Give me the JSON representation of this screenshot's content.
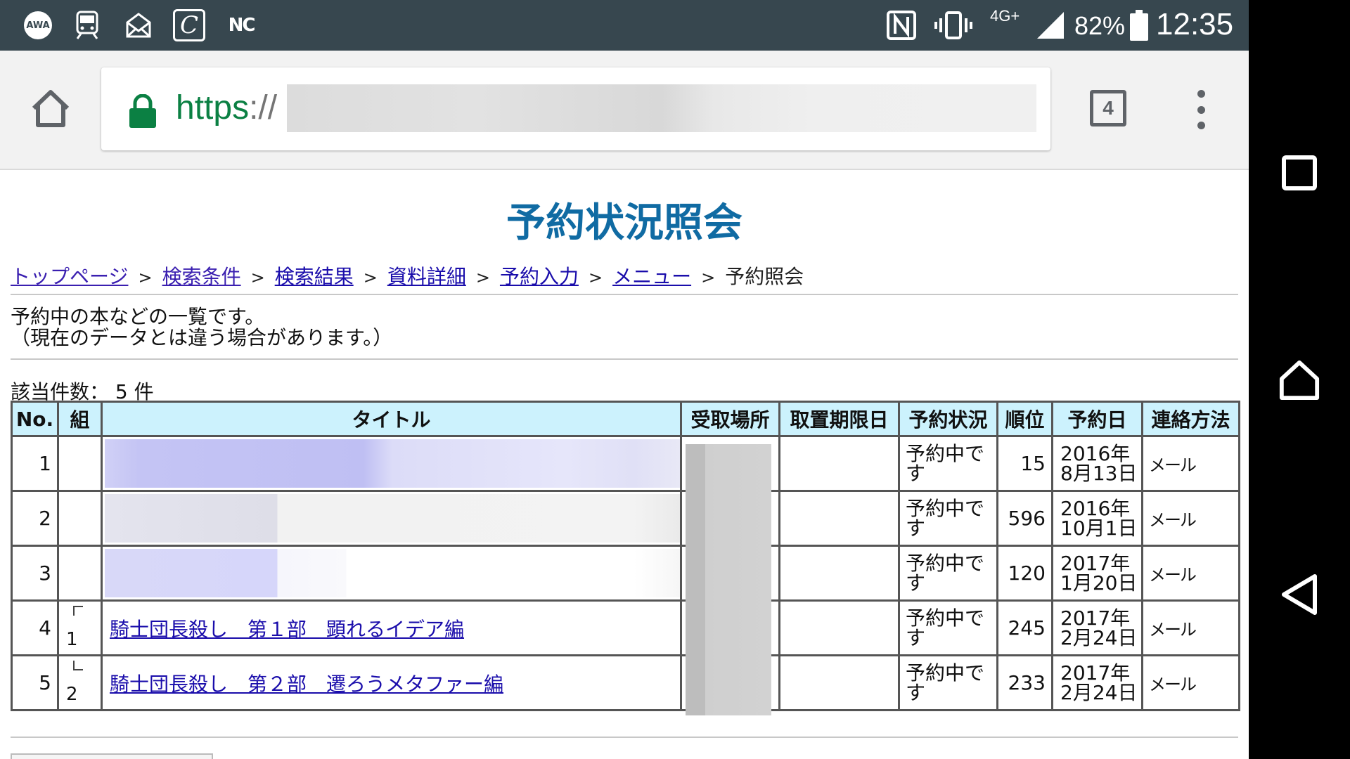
{
  "status_bar": {
    "app_icon_awa": "AWA",
    "app_icon_nc": "NC",
    "network": "4G+",
    "battery_percent": "82%",
    "time": "12:35",
    "icons": [
      "awa-icon",
      "train-icon",
      "mail-icon",
      "c-app-icon",
      "nc-app-icon",
      "nfc-icon",
      "vibrate-icon",
      "signal-icon",
      "battery-icon"
    ]
  },
  "browser": {
    "url_scheme": "https",
    "url_separator": "://",
    "tab_count": "4",
    "colors": {
      "secure_green": "#0b8043",
      "toolbar": "#f2f2f2"
    }
  },
  "page": {
    "title": "予約状況照会",
    "title_color": "#106ba3",
    "breadcrumb": [
      {
        "label": "トップページ",
        "link": true
      },
      {
        "label": "検索条件",
        "link": true
      },
      {
        "label": "検索結果",
        "link": true
      },
      {
        "label": "資料詳細",
        "link": true
      },
      {
        "label": "予約入力",
        "link": true
      },
      {
        "label": "メニュー",
        "link": true
      },
      {
        "label": "予約照会",
        "link": false
      }
    ],
    "breadcrumb_separator": ">",
    "intro_line1": "予約中の本などの一覧です。",
    "intro_line2": "（現在のデータとは違う場合があります。）",
    "count_label": "該当件数：",
    "count_value": "5",
    "count_unit": "件"
  },
  "table": {
    "header_bg": "#ccf2fd",
    "columns": [
      "No.",
      "組",
      "タイトル",
      "受取場所",
      "取置期限日",
      "予約状況",
      "順位",
      "予約日",
      "連絡方法"
    ],
    "rows": [
      {
        "no": "1",
        "group": "",
        "title": "",
        "place": "",
        "deadline": "",
        "status": "予約中です",
        "rank": "15",
        "date": "2016年8月13日",
        "contact": "メール"
      },
      {
        "no": "2",
        "group": "",
        "title": "",
        "place": "",
        "deadline": "",
        "status": "予約中です",
        "rank": "596",
        "date": "2016年10月1日",
        "contact": "メール"
      },
      {
        "no": "3",
        "group": "",
        "title": "",
        "place": "",
        "deadline": "",
        "status": "予約中です",
        "rank": "120",
        "date": "2017年1月20日",
        "contact": "メール"
      },
      {
        "no": "4",
        "group": "1",
        "title": "騎士団長殺し　第１部　顕れるイデア編",
        "place": "",
        "deadline": "",
        "status": "予約中です",
        "rank": "245",
        "date": "2017年2月24日",
        "contact": "メール"
      },
      {
        "no": "5",
        "group": "2",
        "title": "騎士団長殺し　第２部　遷ろうメタファー編",
        "place": "",
        "deadline": "",
        "status": "予約中です",
        "rank": "233",
        "date": "2017年2月24日",
        "contact": "メール"
      }
    ]
  }
}
